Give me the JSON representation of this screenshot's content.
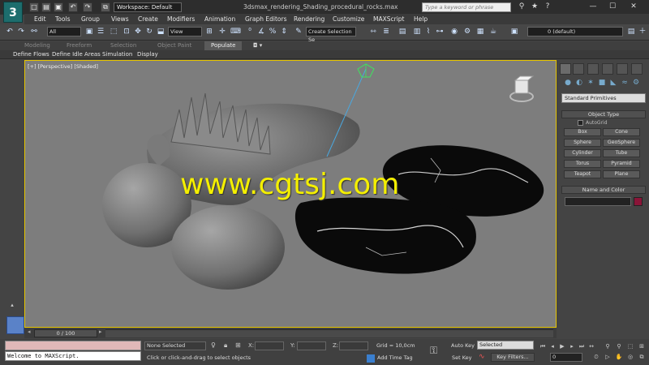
{
  "app": {
    "logo": "3",
    "title": "3dsmax_rendering_Shading_procedural_rocks.max"
  },
  "quick_access": [
    "□",
    "▤",
    "▣",
    "↶",
    "↷",
    "⧉"
  ],
  "workspace": "Workspace: Default",
  "search_placeholder": "Type a keyword or phrase",
  "window_controls": [
    "⚲",
    "★",
    "?",
    "—",
    "☐",
    "✕"
  ],
  "menu": [
    "Edit",
    "Tools",
    "Group",
    "Views",
    "Create",
    "Modifiers",
    "Animation",
    "Graph Editors",
    "Rendering",
    "Customize",
    "MAXScript",
    "Help"
  ],
  "toolbar": {
    "filter": "All",
    "coord_system": "View",
    "selection_set": "Create Selection Se",
    "layer": "0 (default)"
  },
  "ribbon_tabs": [
    "Modeling",
    "Freeform",
    "Selection",
    "Object Paint",
    "Populate"
  ],
  "ribbon_sub": [
    "Define Flows",
    "Define Idle Areas",
    "Simulation",
    "Display"
  ],
  "viewport": {
    "label": "[+] [Perspective] [Shaded]",
    "watermark": "www.cgtsj.com"
  },
  "command_panel": {
    "category": "Standard Primitives",
    "object_type_header": "Object Type",
    "autogrid": "AutoGrid",
    "buttons": [
      "Box",
      "Cone",
      "Sphere",
      "GeoSphere",
      "Cylinder",
      "Tube",
      "Torus",
      "Pyramid",
      "Teapot",
      "Plane"
    ],
    "name_color_header": "Name and Color",
    "object_color": "#8a1538"
  },
  "timeline": {
    "slider": "0 / 100"
  },
  "status": {
    "listener_output": "Welcome to MAXScript.",
    "selection": "None Selected",
    "prompt": "Click or click-and-drag to select objects",
    "x": "X:",
    "y": "Y:",
    "z": "Z:",
    "grid": "Grid = 10,0cm",
    "add_time_tag": "Add Time Tag",
    "auto_key": "Auto Key",
    "set_key": "Set Key",
    "key_mode": "Selected",
    "key_filters": "Key Filters...",
    "current_frame": "0"
  }
}
